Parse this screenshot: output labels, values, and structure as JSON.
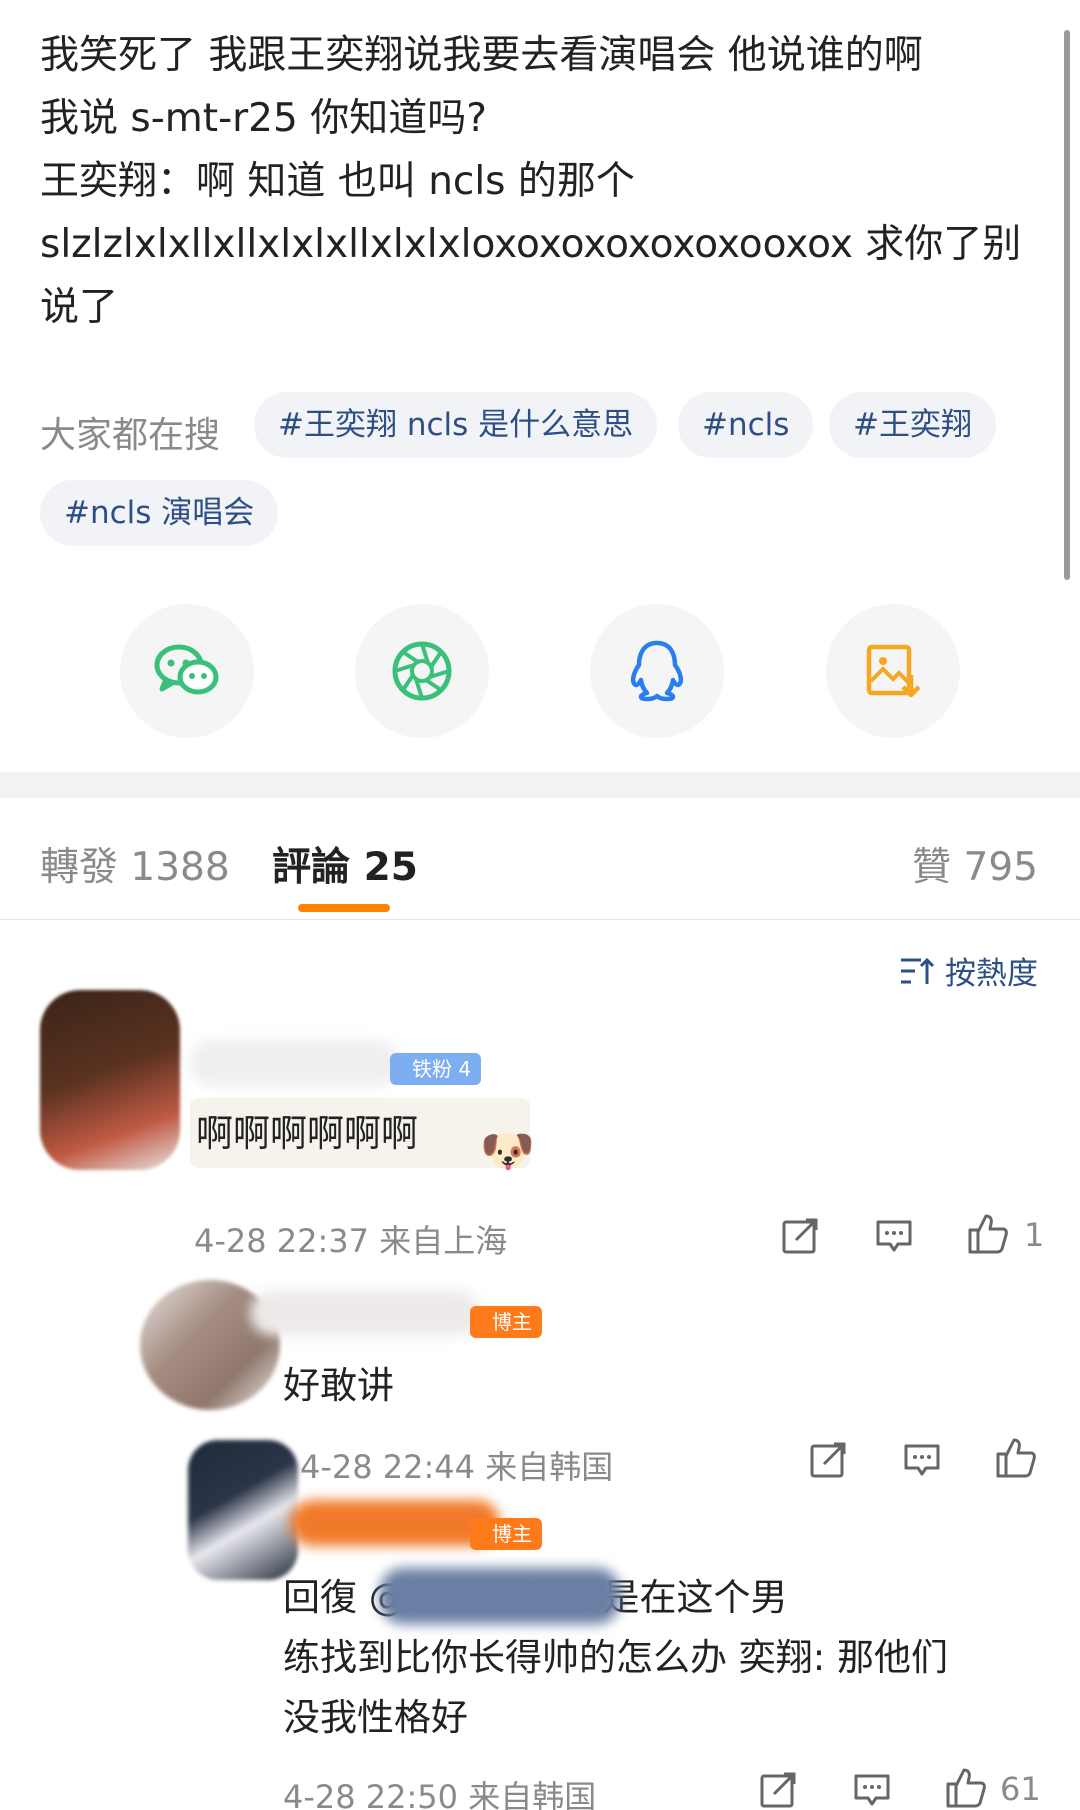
{
  "post": {
    "lines": [
      "我笑死了 我跟王奕翔说我要去看演唱会 他说谁的啊",
      "我说 s-mt-r25 你知道吗?",
      "王奕翔：啊 知道 也叫 ncls 的那个",
      "slzlzlxlxllxllxlxlxllxlxlxloxoxoxoxoxoxooxox 求你了别",
      "说了"
    ]
  },
  "search": {
    "label": "大家都在搜",
    "chips": [
      "#王奕翔 ncls 是什么意思",
      "#ncls",
      "#王奕翔",
      "#ncls 演唱会"
    ]
  },
  "share": {
    "icons": [
      "wechat-icon",
      "moments-icon",
      "qq-icon",
      "save-image-icon"
    ],
    "colors": {
      "wechat": "#39c07a",
      "moments": "#39c07a",
      "qq": "#2a7ff0",
      "save": "#f5a623"
    }
  },
  "tabs": {
    "repost": "轉發 1388",
    "comment": "評論 25",
    "like": "贊 795"
  },
  "sort": {
    "label": "按熱度"
  },
  "comments": [
    {
      "badge": "铁粉 4",
      "text": "啊啊啊啊啊啊",
      "meta": "4-28 22:37  来自上海",
      "like_count": "1"
    },
    {
      "badge": "博主",
      "text": "好敢讲",
      "meta": "4-28 22:44  来自韩国",
      "like_count": ""
    },
    {
      "badge": "博主",
      "text_lines": [
        "回復 @                   我说那我要是在这个男",
        "练找到比你长得帅的怎么办 奕翔: 那他们",
        "没我性格好"
      ],
      "meta": "4-28 22:50  来自韩国",
      "like_count": "61"
    }
  ],
  "accent": "#ff8200",
  "link_color": "#2d4f86"
}
